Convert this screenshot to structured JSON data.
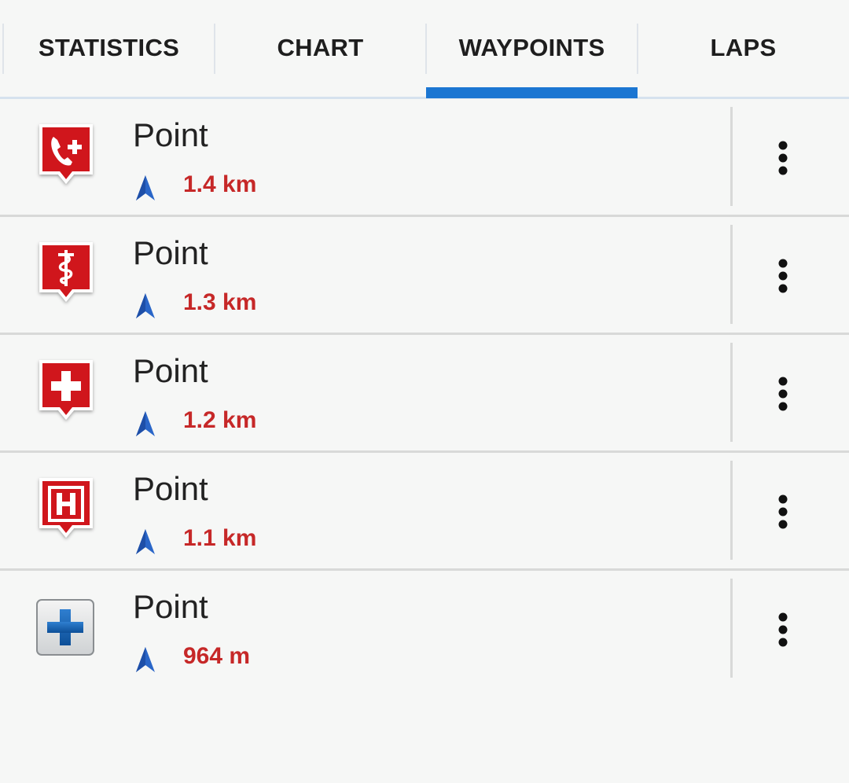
{
  "tabs": [
    {
      "label": "STATISTICS",
      "active": false
    },
    {
      "label": "CHART",
      "active": false
    },
    {
      "label": "WAYPOINTS",
      "active": true
    },
    {
      "label": "LAPS",
      "active": false
    }
  ],
  "colors": {
    "accent": "#1b76d2",
    "distance": "#c62828",
    "waypoint_red": "#d0191e",
    "arrow_blue": "#2a66c8"
  },
  "waypoints": [
    {
      "title": "Point",
      "distance": "1.4 km",
      "icon": "emergency-phone-icon"
    },
    {
      "title": "Point",
      "distance": "1.3 km",
      "icon": "medical-caduceus-icon"
    },
    {
      "title": "Point",
      "distance": "1.2 km",
      "icon": "first-aid-cross-icon"
    },
    {
      "title": "Point",
      "distance": "1.1 km",
      "icon": "hospital-h-icon"
    },
    {
      "title": "Point",
      "distance": "964 m",
      "icon": "blue-cross-icon"
    }
  ]
}
